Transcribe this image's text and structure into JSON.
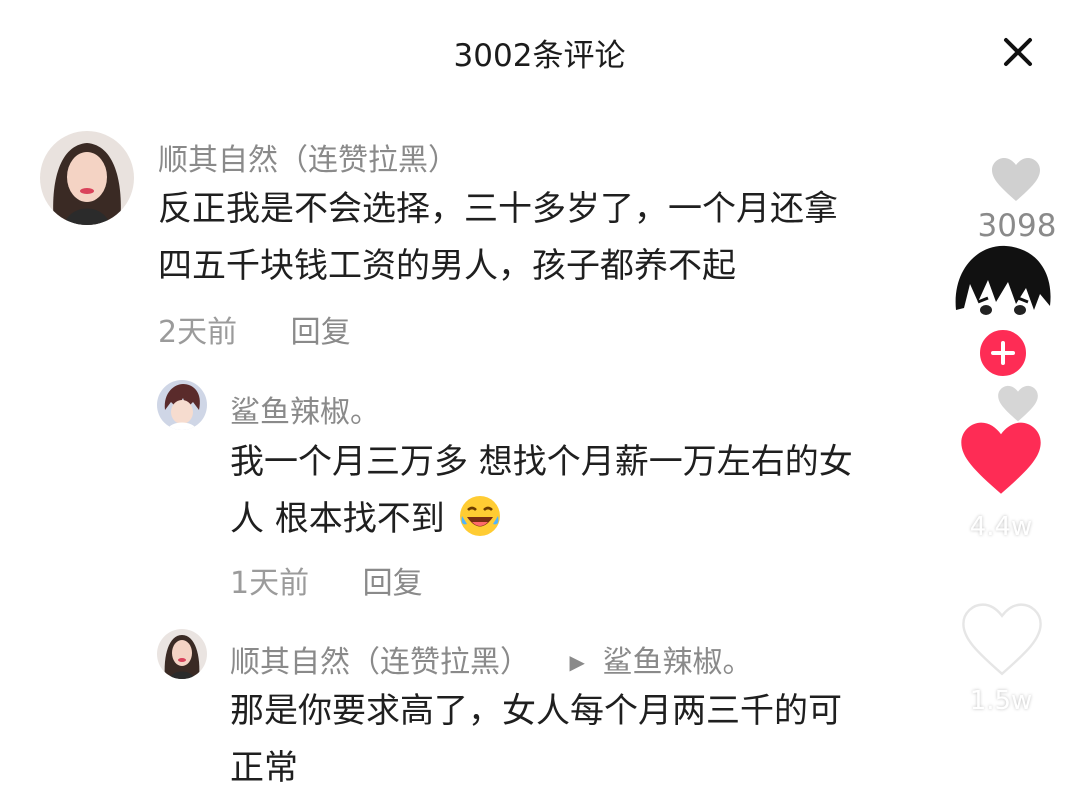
{
  "header": {
    "title": "3002条评论",
    "close_icon": "close-icon"
  },
  "comments": [
    {
      "author": "顺其自然（连赞拉黑）",
      "text_lines": [
        "反正我是不会选择，三十多岁了，一个月还拿",
        "四五千块钱工资的男人，孩子都养不起"
      ],
      "time": "2天前",
      "reply_label": "回复",
      "likes": "3098"
    },
    {
      "author": "鲨鱼辣椒。",
      "text_lines": [
        "我一个月三万多 想找个月薪一万左右的女",
        "人 根本找不到"
      ],
      "emoji": "laughing-crying-emoji",
      "time": "1天前",
      "reply_label": "回复"
    },
    {
      "author": "顺其自然（连赞拉黑）",
      "reply_to": "鲨鱼辣椒。",
      "text_lines": [
        "那是你要求高了，女人每个月两三千的可",
        "正常"
      ]
    }
  ],
  "overlay": {
    "like_count": "4.4w",
    "favorite_count": "1.5w",
    "colors": {
      "like_red": "#fe2c55",
      "follow_red": "#fe2c55"
    }
  }
}
